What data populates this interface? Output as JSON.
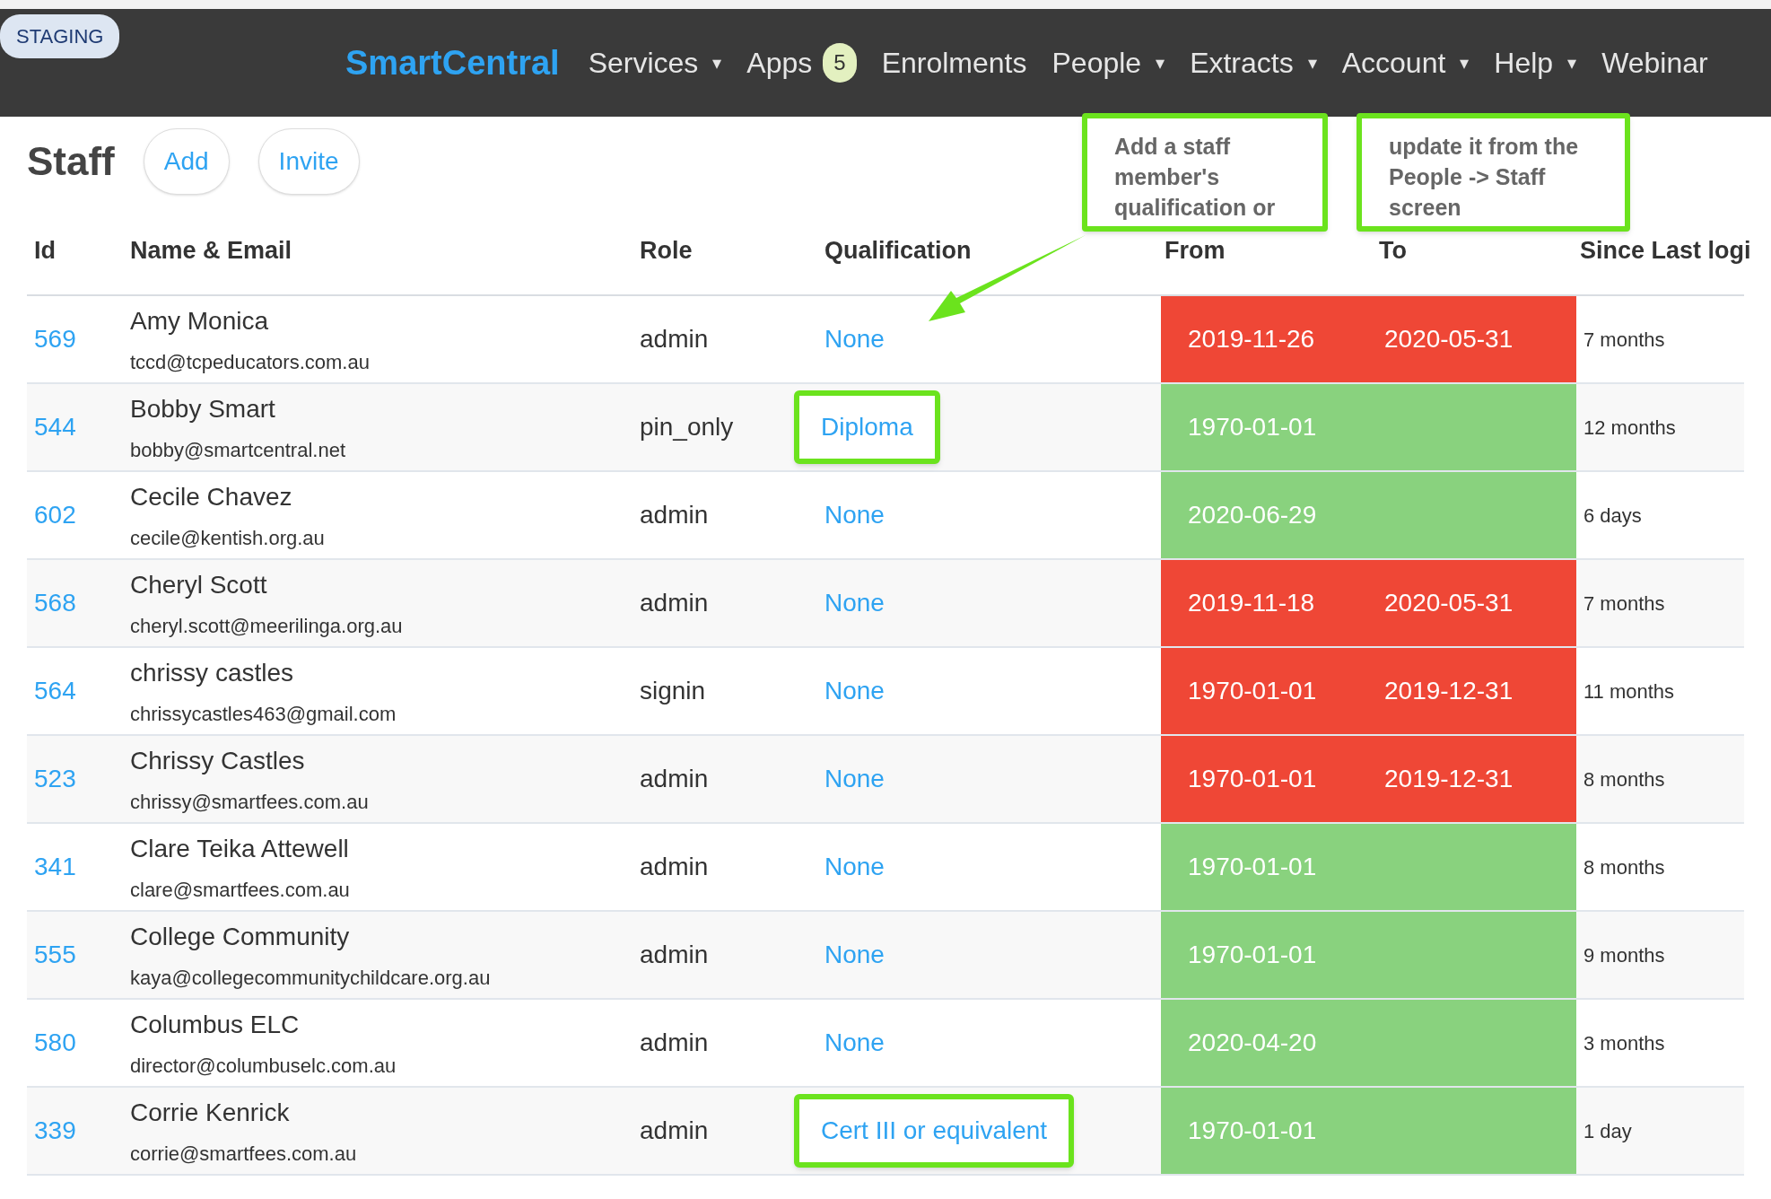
{
  "env_badge": "STAGING",
  "brand": "SmartCentral",
  "nav": [
    {
      "label": "Services",
      "caret": "▾"
    },
    {
      "label": "Apps",
      "badge": "5"
    },
    {
      "label": "Enrolments"
    },
    {
      "label": "People",
      "caret": "▾"
    },
    {
      "label": "Extracts",
      "caret": "▾"
    },
    {
      "label": "Account",
      "caret": "▾"
    },
    {
      "label": "Help",
      "caret": "▾"
    },
    {
      "label": "Webinar"
    }
  ],
  "page_title": "Staff",
  "actions": [
    "Add",
    "Invite"
  ],
  "annotations": [
    "Add a staff member's qualification or",
    "update it from the People -> Staff screen"
  ],
  "table": {
    "columns": [
      "Id",
      "Name & Email",
      "Role",
      "Qualification",
      "From",
      "To",
      "Since Last logi"
    ],
    "rows": [
      {
        "id": "569",
        "name": "Amy Monica",
        "email": "tccd@tcpeducators.com.au",
        "role": "admin",
        "qualification": "None",
        "highlighted": false,
        "from": "2019-11-26",
        "to": "2020-05-31",
        "expired": true,
        "since": "7 months"
      },
      {
        "id": "544",
        "name": "Bobby Smart",
        "email": "bobby@smartcentral.net",
        "role": "pin_only",
        "qualification": "Diploma",
        "highlighted": true,
        "from": "1970-01-01",
        "expired": false,
        "since": "12 months"
      },
      {
        "id": "602",
        "name": "Cecile Chavez",
        "email": "cecile@kentish.org.au",
        "role": "admin",
        "qualification": "None",
        "highlighted": false,
        "from": "2020-06-29",
        "expired": false,
        "since": "6 days"
      },
      {
        "id": "568",
        "name": "Cheryl Scott",
        "email": "cheryl.scott@meerilinga.org.au",
        "role": "admin",
        "qualification": "None",
        "highlighted": false,
        "from": "2019-11-18",
        "to": "2020-05-31",
        "expired": true,
        "since": "7 months"
      },
      {
        "id": "564",
        "name": "chrissy castles",
        "email": "chrissycastles463@gmail.com",
        "role": "signin",
        "qualification": "None",
        "highlighted": false,
        "from": "1970-01-01",
        "to": "2019-12-31",
        "expired": true,
        "since": "11 months"
      },
      {
        "id": "523",
        "name": "Chrissy Castles",
        "email": "chrissy@smartfees.com.au",
        "role": "admin",
        "qualification": "None",
        "highlighted": false,
        "from": "1970-01-01",
        "to": "2019-12-31",
        "expired": true,
        "since": "8 months"
      },
      {
        "id": "341",
        "name": "Clare Teika Attewell",
        "email": "clare@smartfees.com.au",
        "role": "admin",
        "qualification": "None",
        "highlighted": false,
        "from": "1970-01-01",
        "expired": false,
        "since": "8 months"
      },
      {
        "id": "555",
        "name": "College Community",
        "email": "kaya@collegecommunitychildcare.org.au",
        "role": "admin",
        "qualification": "None",
        "highlighted": false,
        "from": "1970-01-01",
        "expired": false,
        "since": "9 months"
      },
      {
        "id": "580",
        "name": "Columbus ELC",
        "email": "director@columbuselc.com.au",
        "role": "admin",
        "qualification": "None",
        "highlighted": false,
        "from": "2020-04-20",
        "expired": false,
        "since": "3 months"
      },
      {
        "id": "339",
        "name": "Corrie Kenrick",
        "email": "corrie@smartfees.com.au",
        "role": "admin",
        "qualification": "Cert III or equivalent",
        "highlighted": true,
        "from": "1970-01-01",
        "expired": false,
        "since": "1 day"
      }
    ]
  }
}
